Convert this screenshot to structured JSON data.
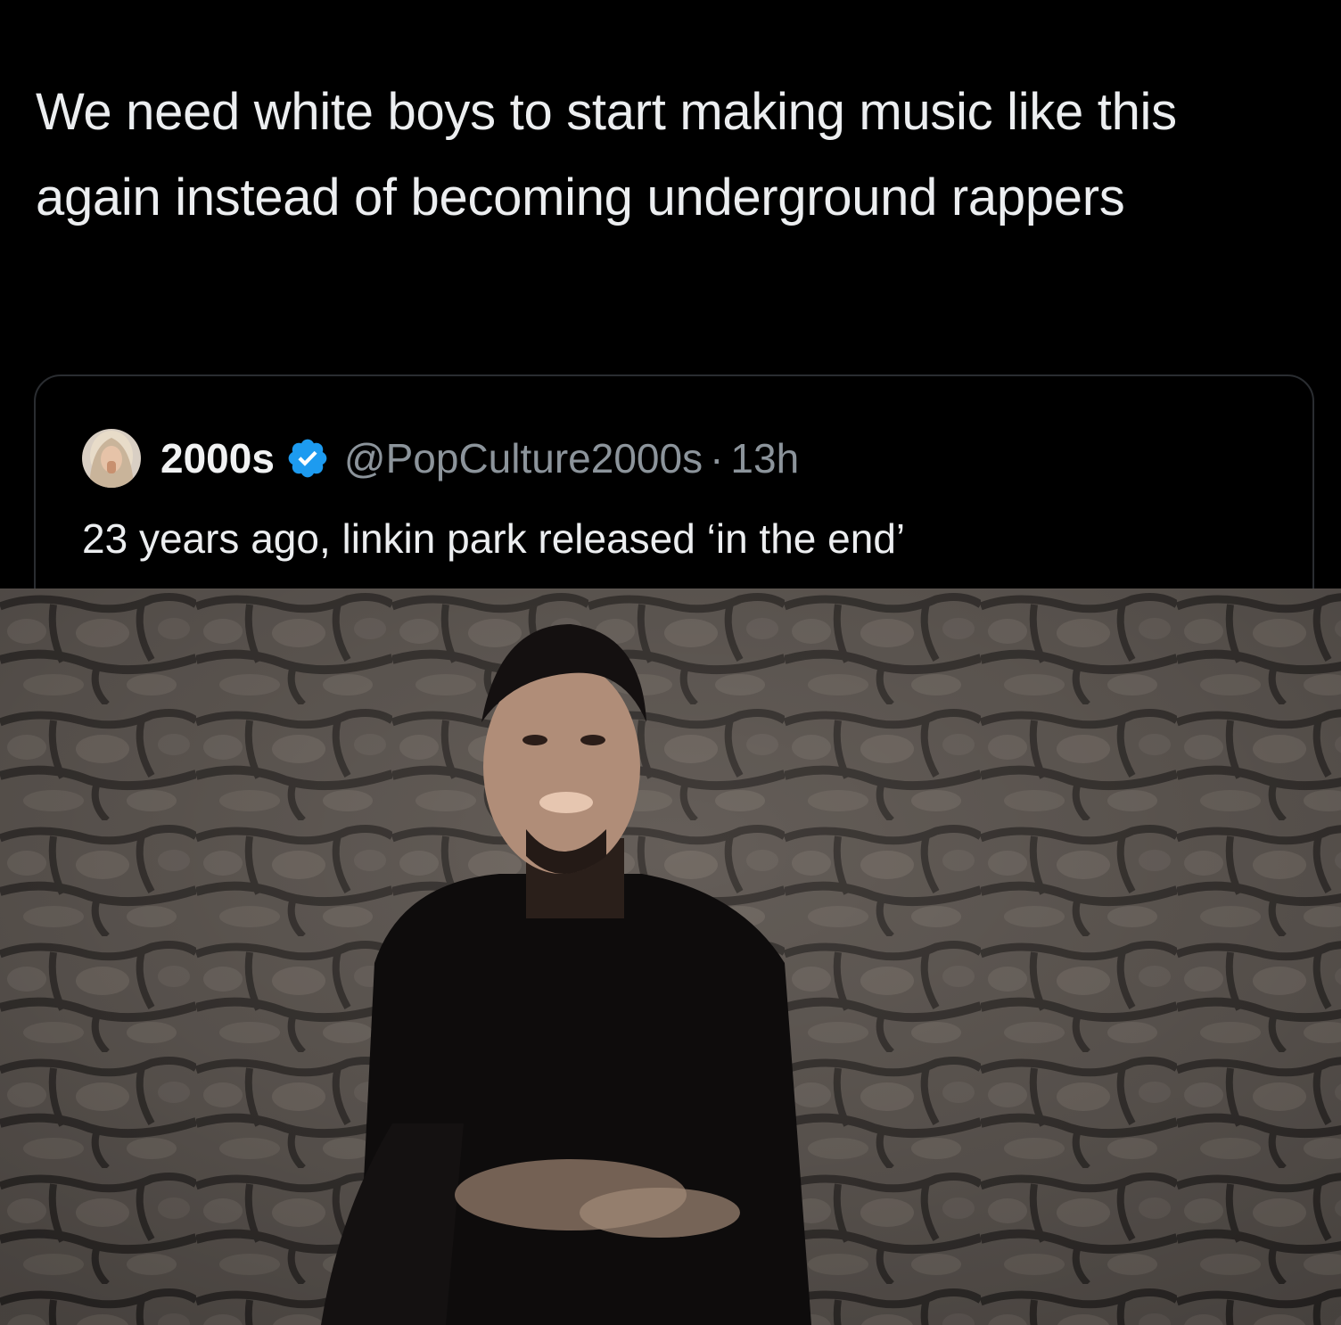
{
  "tweet": {
    "text": "We need white boys to start making music like this again instead of becoming underground rappers"
  },
  "quoted_tweet": {
    "avatar_icon": "user-avatar",
    "display_name": "2000s",
    "verified_icon": "verified-badge-icon",
    "handle": "@PopCulture2000s",
    "separator": "·",
    "time": "13h",
    "text": "23 years ago, linkin park released ‘in the end’"
  },
  "colors": {
    "background": "#000000",
    "text_primary": "#eceef0",
    "text_secondary": "#8c949b",
    "verified_blue": "#1d9bf0",
    "card_border": "#2a2d31"
  }
}
